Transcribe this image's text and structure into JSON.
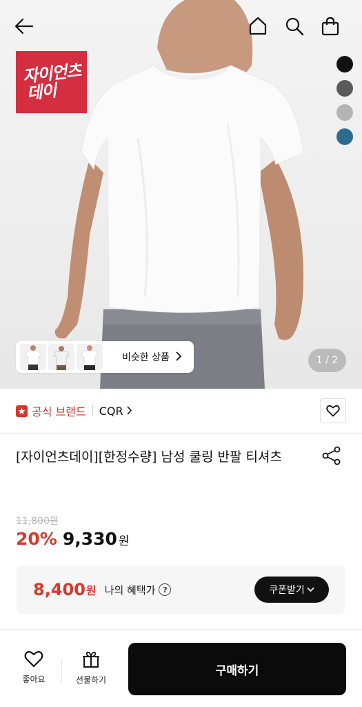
{
  "header": {
    "icons": [
      "back-arrow-icon",
      "home-icon",
      "search-icon",
      "shopping-bag-icon"
    ]
  },
  "hero": {
    "brand_badge_line1": "자이언츠",
    "brand_badge_line2": "데이",
    "color_swatches": [
      "#111111",
      "#5a5a5a",
      "#b4b4b4",
      "#2f6b8c"
    ],
    "similar_label": "비슷한 상품",
    "pager": "1 / 2"
  },
  "brand_row": {
    "official_label": "공식 브랜드",
    "brand_name": "CQR"
  },
  "product": {
    "title": "[자이언츠데이][한정수량] 남성 쿨링 반팔 티셔츠",
    "original_price": "11,800원",
    "discount": "20%",
    "price": "9,330",
    "currency": "원"
  },
  "benefit": {
    "price": "8,400",
    "currency": "원",
    "label": "나의 혜택가",
    "help": "?",
    "coupon_label": "쿠폰받기"
  },
  "bottom_bar": {
    "like_label": "좋아요",
    "gift_label": "선물하기",
    "buy_label": "구매하기"
  },
  "colors": {
    "accent_red": "#d63a2c",
    "brand_badge": "#d42e40",
    "dark_button": "#0b0b0b"
  }
}
